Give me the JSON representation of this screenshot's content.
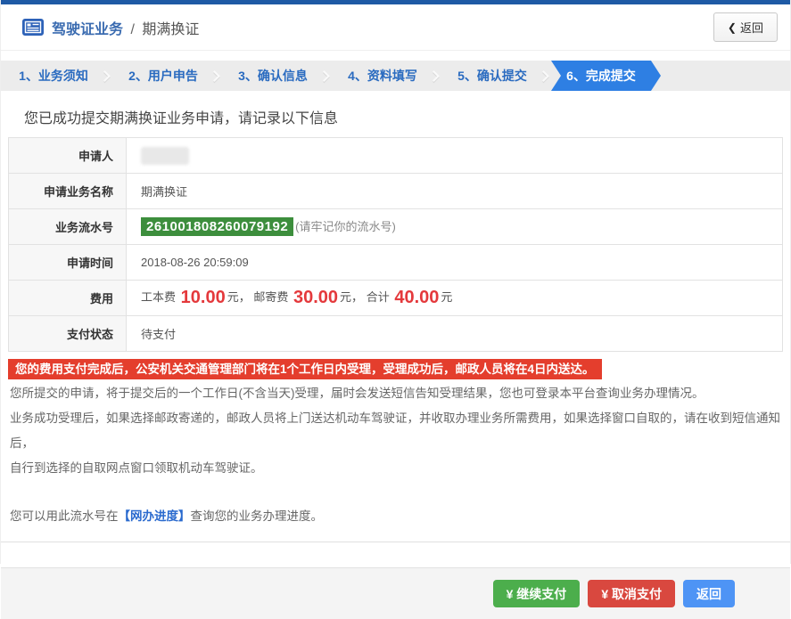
{
  "header": {
    "title_primary": "驾驶证业务",
    "title_separator": "/",
    "title_secondary": "期满换证",
    "back_icon": "❮",
    "back_label": "返回"
  },
  "steps": [
    {
      "label": "1、业务须知",
      "active": false
    },
    {
      "label": "2、用户申告",
      "active": false
    },
    {
      "label": "3、确认信息",
      "active": false
    },
    {
      "label": "4、资料填写",
      "active": false
    },
    {
      "label": "5、确认提交",
      "active": false
    },
    {
      "label": "6、完成提交",
      "active": true
    }
  ],
  "main": {
    "success_message": "您已成功提交期满换证业务申请，请记录以下信息",
    "table": {
      "applicant_label": "申请人",
      "service_label": "申请业务名称",
      "service_value": "期满换证",
      "serial_label": "业务流水号",
      "serial_value": "261001808260079192",
      "serial_note": "(请牢记你的流水号)",
      "time_label": "申请时间",
      "time_value": "2018-08-26 20:59:09",
      "fee_label": "费用",
      "fee_item1_label": "工本费",
      "fee_item1_value": "10.00",
      "fee_item1_unit": "元，",
      "fee_item2_label": "邮寄费",
      "fee_item2_value": "30.00",
      "fee_item2_unit": "元，",
      "fee_total_label": "合计",
      "fee_total_value": "40.00",
      "fee_total_unit": "元",
      "status_label": "支付状态",
      "status_value": "待支付"
    },
    "notice": {
      "warning": "您的费用支付完成后，公安机关交通管理部门将在1个工作日内受理，受理成功后，邮政人员将在4日内送达。",
      "p1": "您所提交的申请，将于提交后的一个工作日(不含当天)受理，届时会发送短信告知受理结果，您也可登录本平台查询业务办理情况。",
      "p2_line1": "业务成功受理后，如果选择邮政寄递的，邮政人员将上门送达机动车驾驶证，并收取办理业务所需费用，如果选择窗口自取的，请在收到短信通知后，",
      "p2_line2": "自行到选择的自取网点窗口领取机动车驾驶证。",
      "p3_prefix": "您可以用此流水号在",
      "p3_link": "【网办进度】",
      "p3_suffix": "查询您的业务办理进度。"
    }
  },
  "footer": {
    "continue_label": "¥ 继续支付",
    "cancel_label": "¥ 取消支付",
    "back_label": "返回"
  },
  "colors": {
    "topbar_blue": "#1e5aa5",
    "link_blue": "#3a6bb0",
    "active_step_blue": "#2e7fe3",
    "serial_green": "#3d8e3d",
    "warning_red": "#e43e2d",
    "fee_red": "#e4393c",
    "button_green": "#4cae4c",
    "button_red": "#d9483f",
    "button_blue": "#4e94f5"
  }
}
